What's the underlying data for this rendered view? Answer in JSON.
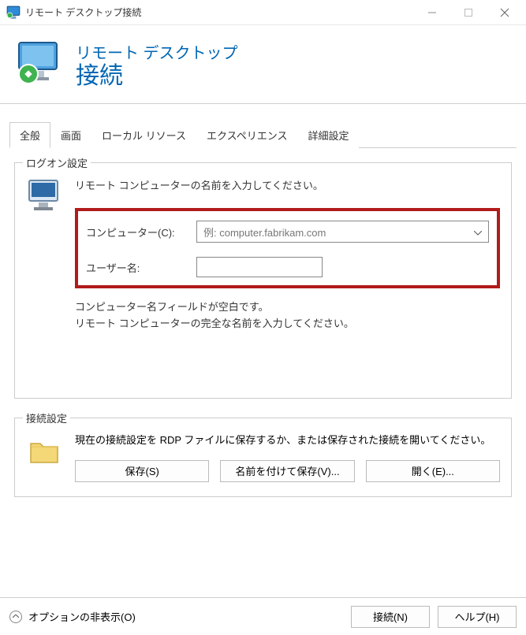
{
  "window": {
    "title": "リモート デスクトップ接続"
  },
  "banner": {
    "line1": "リモート デスクトップ",
    "line2": "接続"
  },
  "tabs": [
    {
      "label": "全般",
      "active": true
    },
    {
      "label": "画面"
    },
    {
      "label": "ローカル リソース"
    },
    {
      "label": "エクスペリエンス"
    },
    {
      "label": "詳細設定"
    }
  ],
  "logon": {
    "title": "ログオン設定",
    "instruction": "リモート コンピューターの名前を入力してください。",
    "computer_label": "コンピューター(C):",
    "computer_placeholder": "例: computer.fabrikam.com",
    "computer_value": "",
    "username_label": "ユーザー名:",
    "username_value": "",
    "hint_line1": "コンピューター名フィールドが空白です。",
    "hint_line2": "リモート コンピューターの完全な名前を入力してください。"
  },
  "connection": {
    "title": "接続設定",
    "instruction": "現在の接続設定を RDP ファイルに保存するか、または保存された接続を開いてください。",
    "save_label": "保存(S)",
    "saveas_label": "名前を付けて保存(V)...",
    "open_label": "開く(E)..."
  },
  "footer": {
    "options_label": "オプションの非表示(O)",
    "connect_label": "接続(N)",
    "help_label": "ヘルプ(H)"
  }
}
